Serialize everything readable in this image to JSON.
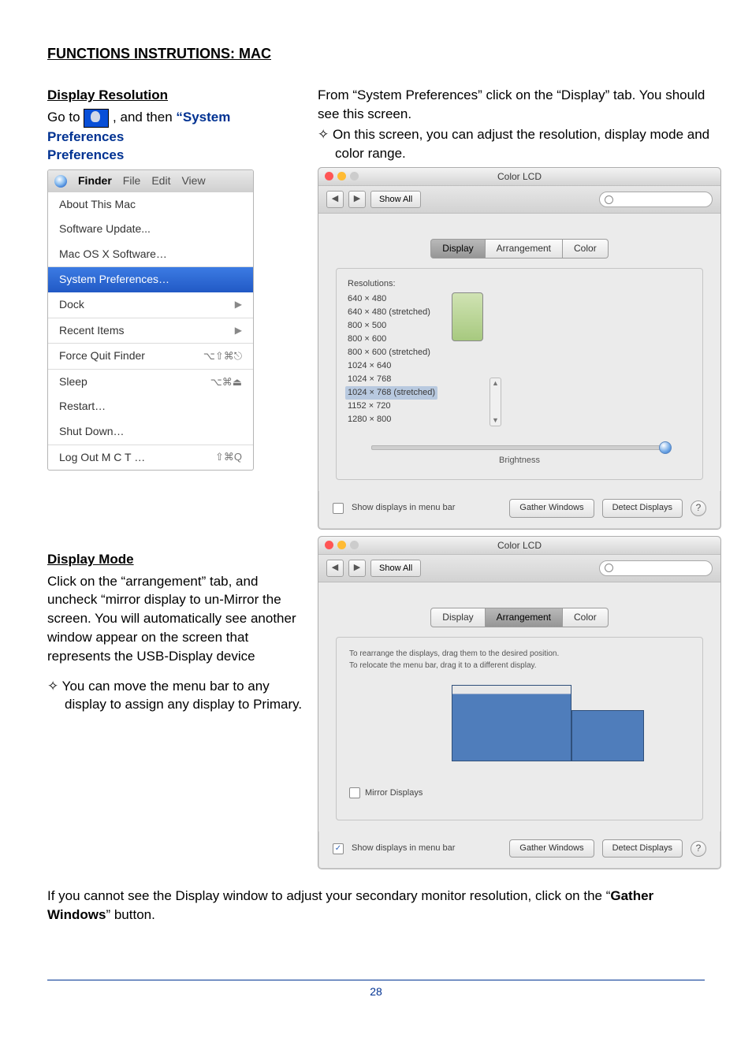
{
  "section_heading": "FUNCTIONS INSTRUTIONS: MAC",
  "dispres": {
    "heading": "Display Resolution",
    "goto_pre": "Go to ",
    "goto_post": ", and then ",
    "sys_pref": "“System Preferences"
  },
  "apple_menu": {
    "bar": [
      "Finder",
      "File",
      "Edit",
      "View"
    ],
    "grp1": [
      "About This Mac",
      "Software Update...",
      "Mac OS X Software…"
    ],
    "hl": "System Preferences…",
    "dock": "Dock",
    "recent": "Recent Items",
    "force": "Force Quit Finder",
    "force_kb": "⌥⇧⌘⎋",
    "grp4": [
      "Sleep",
      "Restart…",
      "Shut Down…"
    ],
    "grp4_kb": "⌥⌘⏏",
    "logout": "Log Out M C T …",
    "logout_kb": "⇧⌘Q"
  },
  "right_intro1": "From “System Preferences” click on the “Display” tab. You should see this screen.",
  "right_bullet1": "On this screen, you can adjust the resolution, display mode and color range.",
  "win1": {
    "title": "Color LCD",
    "showall": "Show All",
    "tabs": [
      "Display",
      "Arrangement",
      "Color"
    ],
    "res_label": "Resolutions:",
    "res": [
      "640 × 480",
      "640 × 480 (stretched)",
      "800 × 500",
      "800 × 600",
      "800 × 600 (stretched)",
      "1024 × 640",
      "1024 × 768",
      "1024 × 768 (stretched)",
      "1152 × 720",
      "1280 × 800"
    ],
    "brightness": "Brightness",
    "show_menu": "Show displays in menu bar",
    "gather": "Gather Windows",
    "detect": "Detect Displays"
  },
  "dispmode": {
    "heading": "Display Mode",
    "p1": "Click on the “arrangement” tab, and uncheck “mirror display to un-Mirror the screen. You will automatically see another window appear on the screen that represents the USB-Display device",
    "bul": "You can move the menu bar to any display to assign any display to Primary."
  },
  "win2": {
    "title": "Color LCD",
    "showall": "Show All",
    "tabs": [
      "Display",
      "Arrangement",
      "Color"
    ],
    "hint1": "To rearrange the displays, drag them to the desired position.",
    "hint2": "To relocate the menu bar, drag it to a different display.",
    "mirror": "Mirror Displays",
    "show_menu": "Show displays in menu bar",
    "gather": "Gather Windows",
    "detect": "Detect Displays"
  },
  "closing_p": "If you cannot see the Display window to adjust your secondary monitor resolution, click on the “",
  "closing_bold": "Gather Windows",
  "closing_tail": "” button.",
  "page_no": "28"
}
